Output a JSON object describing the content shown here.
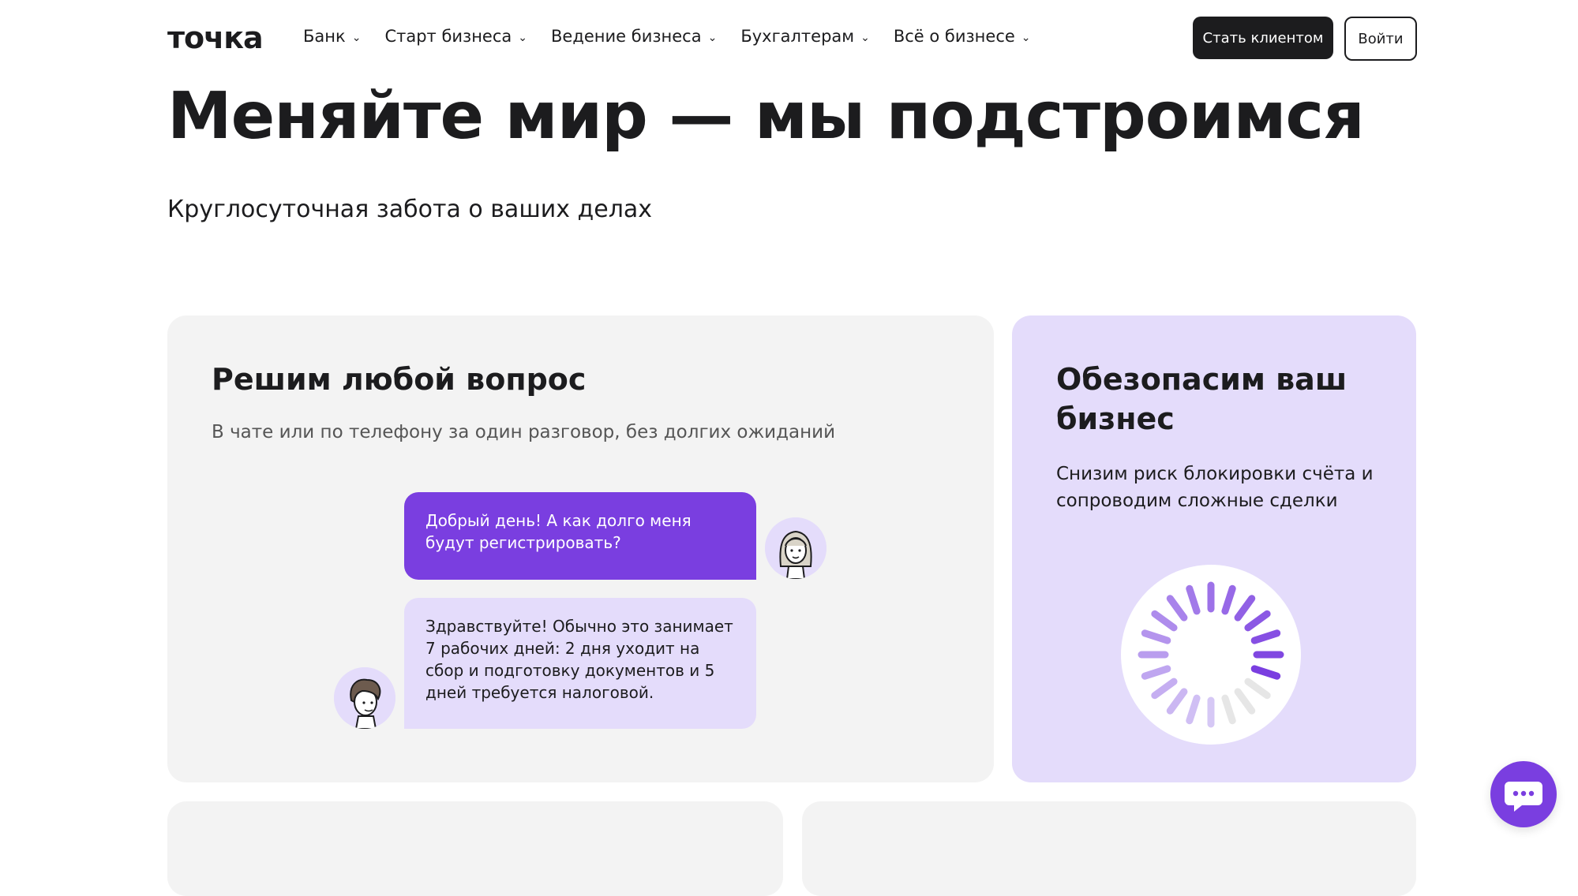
{
  "header": {
    "logo": "точка",
    "nav": [
      {
        "label": "Банк"
      },
      {
        "label": "Старт бизнеса"
      },
      {
        "label": "Ведение бизнеса"
      },
      {
        "label": "Бухгалтерам"
      },
      {
        "label": "Всё о бизнесе"
      }
    ],
    "become_client_label": "Стать клиентом",
    "login_label": "Войти"
  },
  "hero": {
    "title": "Меняйте мир — мы подстроимся",
    "subtitle": "Круглосуточная забота о ваших делах"
  },
  "card_support": {
    "title": "Решим любой вопрос",
    "description": "В чате или по телефону за один разговор, без долгих ожиданий",
    "chat": {
      "user_message": "Добрый день! А как долго меня будут регистрировать?",
      "agent_message": "Здравствуйте! Обычно это занимает 7 рабочих дней: 2 дня уходит на сбор и подготовку документов и 5 дней требуется налоговой."
    }
  },
  "card_security": {
    "title": "Обезопасим ваш бизнес",
    "description": "Снизим риск блокировки счёта и сопроводим сложные сделки"
  },
  "colors": {
    "accent": "#7a3ee0",
    "accent_light": "#e4dcfb",
    "card_gray": "#f3f3f3",
    "text_dark": "#1c1c1e"
  },
  "icons": {
    "chat_fab": "chat-bubble-icon",
    "nav_chevron": "chevron-down-icon",
    "spinner": "loading-spinner-icon"
  }
}
